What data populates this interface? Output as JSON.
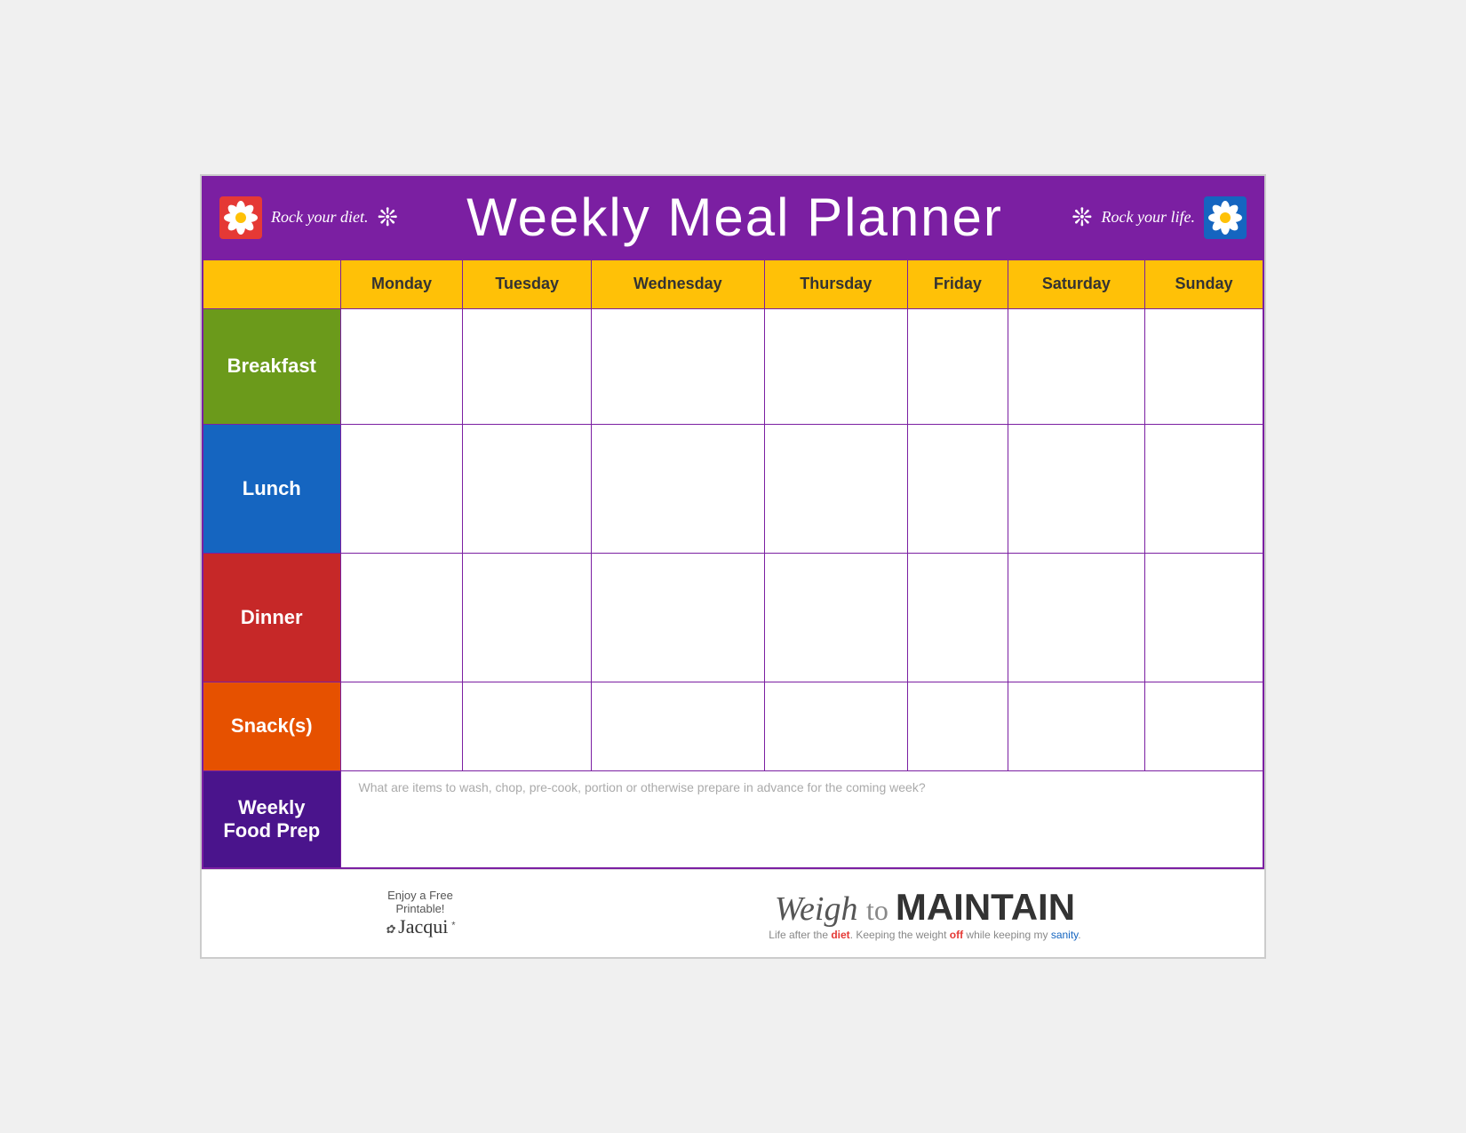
{
  "header": {
    "rock_diet": "Rock your diet.",
    "title": "Weekly Meal Planner",
    "rock_life": "Rock your life.",
    "snowflake": "❊"
  },
  "days": {
    "empty_col": "",
    "columns": [
      "Monday",
      "Tuesday",
      "Wednesday",
      "Thursday",
      "Friday",
      "Saturday",
      "Sunday"
    ]
  },
  "rows": [
    {
      "label": "Breakfast",
      "class": "breakfast-label"
    },
    {
      "label": "Lunch",
      "class": "lunch-label"
    },
    {
      "label": "Dinner",
      "class": "dinner-label"
    },
    {
      "label": "Snack(s)",
      "class": "snacks-label"
    },
    {
      "label": "Weekly\nFood Prep",
      "class": "weekly-label"
    }
  ],
  "weekly_prep_placeholder": "What are items to wash, chop, pre-cook, portion or otherwise prepare in advance for the coming week?",
  "footer": {
    "enjoy": "Enjoy a Free",
    "printable": "Printable!",
    "jacqui": "Jacqui",
    "brand_weigh": "Weigh",
    "brand_to": " to ",
    "brand_maintain": "MAINTAIN",
    "tagline": "Life after the diet. Keeping the weight off while keeping my sanity."
  }
}
